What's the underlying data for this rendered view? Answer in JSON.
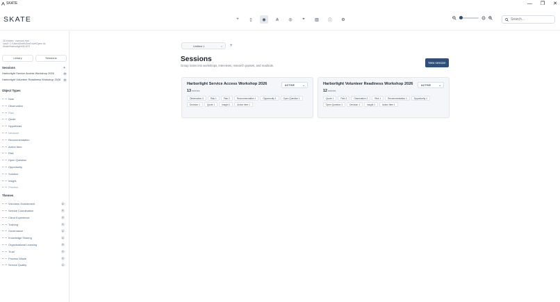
{
  "window": {
    "title": "SKATE",
    "minimize": "—",
    "maximize": "❐",
    "close": "✕"
  },
  "brand": {
    "name": "SKATE"
  },
  "toolbar": {
    "tools": [
      {
        "name": "add-tool",
        "glyph": "+"
      },
      {
        "name": "library-tool",
        "glyph": "▯"
      },
      {
        "name": "explore-tool",
        "glyph": "◉",
        "active": true
      },
      {
        "name": "share-tool",
        "glyph": "⋔"
      },
      {
        "name": "view-tool",
        "glyph": "◎"
      },
      {
        "name": "location-tool",
        "glyph": "⌖"
      },
      {
        "name": "chart-tool",
        "glyph": "▥"
      },
      {
        "name": "info-tool",
        "glyph": "ⓘ"
      },
      {
        "name": "settings-tool",
        "glyph": "⚙"
      }
    ],
    "search_placeholder": "Search..."
  },
  "sidebar": {
    "stats_line1": "25 entries · memory tree",
    "stats_line2": "Vault: C:\\Users\\Bree\\OneDrive\\Open dc",
    "stats_line3": "Skate\\Harborlight\\SKATE",
    "tab_library": "Library",
    "tab_sessions": "Sessions",
    "sessions_heading": "Sessions",
    "sessions_add": "+",
    "sessions": [
      {
        "label": "Harborlight Service Access Workshop 2026",
        "count": "13"
      },
      {
        "label": "Harborlight Volunteer Readiness Workshop 2026",
        "count": "12"
      }
    ],
    "object_types_heading": "Object Types",
    "object_types": [
      {
        "label": "Note",
        "muted": false
      },
      {
        "label": "Observation",
        "muted": false
      },
      {
        "label": "Pain",
        "muted": true
      },
      {
        "label": "Quote",
        "muted": false
      },
      {
        "label": "Hypothesis",
        "muted": false
      },
      {
        "label": "Decision",
        "muted": true
      },
      {
        "label": "Recommendation",
        "muted": false
      },
      {
        "label": "Action Item",
        "muted": false
      },
      {
        "label": "Risk",
        "muted": false
      },
      {
        "label": "Open Question",
        "muted": false
      },
      {
        "label": "Opportunity",
        "muted": false
      },
      {
        "label": "Solution",
        "muted": false
      },
      {
        "label": "Insight",
        "muted": false
      },
      {
        "label": "Process",
        "muted": true
      }
    ],
    "themes_heading": "Themes",
    "themes": [
      {
        "label": "Volunteer Enablement",
        "count": "6"
      },
      {
        "label": "Service Coordination",
        "count": "4"
      },
      {
        "label": "Client Experience",
        "count": "3"
      },
      {
        "label": "Training",
        "count": "3"
      },
      {
        "label": "Governance",
        "count": "4"
      },
      {
        "label": "Knowledge Sharing",
        "count": "4"
      },
      {
        "label": "Organisational Learning",
        "count": "4"
      },
      {
        "label": "Trust",
        "count": "2"
      },
      {
        "label": "Process Waste",
        "count": "2"
      },
      {
        "label": "Service Quality",
        "count": "2"
      }
    ]
  },
  "main": {
    "doc_tab": "Untitled 1",
    "doc_tab_close": "×",
    "add_tab": "+",
    "title": "Sessions",
    "subtitle": "Group notes into workshops, interviews, research passes, and readouts.",
    "new_session": "New session",
    "cards": [
      {
        "title": "Harborlight Service Access Workshop 2026",
        "status": "ACTIVE",
        "count": "13",
        "entries_label": "entries",
        "chips": [
          "Observation 3",
          "Risk 1",
          "Pain 2",
          "Recommendation 1",
          "Opportunity 1",
          "Open Question 1",
          "Decision 1",
          "Quote 1",
          "Insight 1",
          "Action Item 1"
        ]
      },
      {
        "title": "Harborlight Volunteer Readiness Workshop 2026",
        "status": "ACTIVE",
        "count": "12",
        "entries_label": "entries",
        "chips": [
          "Quote 1",
          "Pain 2",
          "Observation 2",
          "Risk 1",
          "Recommendation 1",
          "Opportunity 1",
          "Open Question 1",
          "Decision 1",
          "Insight 1",
          "Action Item 1"
        ]
      }
    ]
  }
}
